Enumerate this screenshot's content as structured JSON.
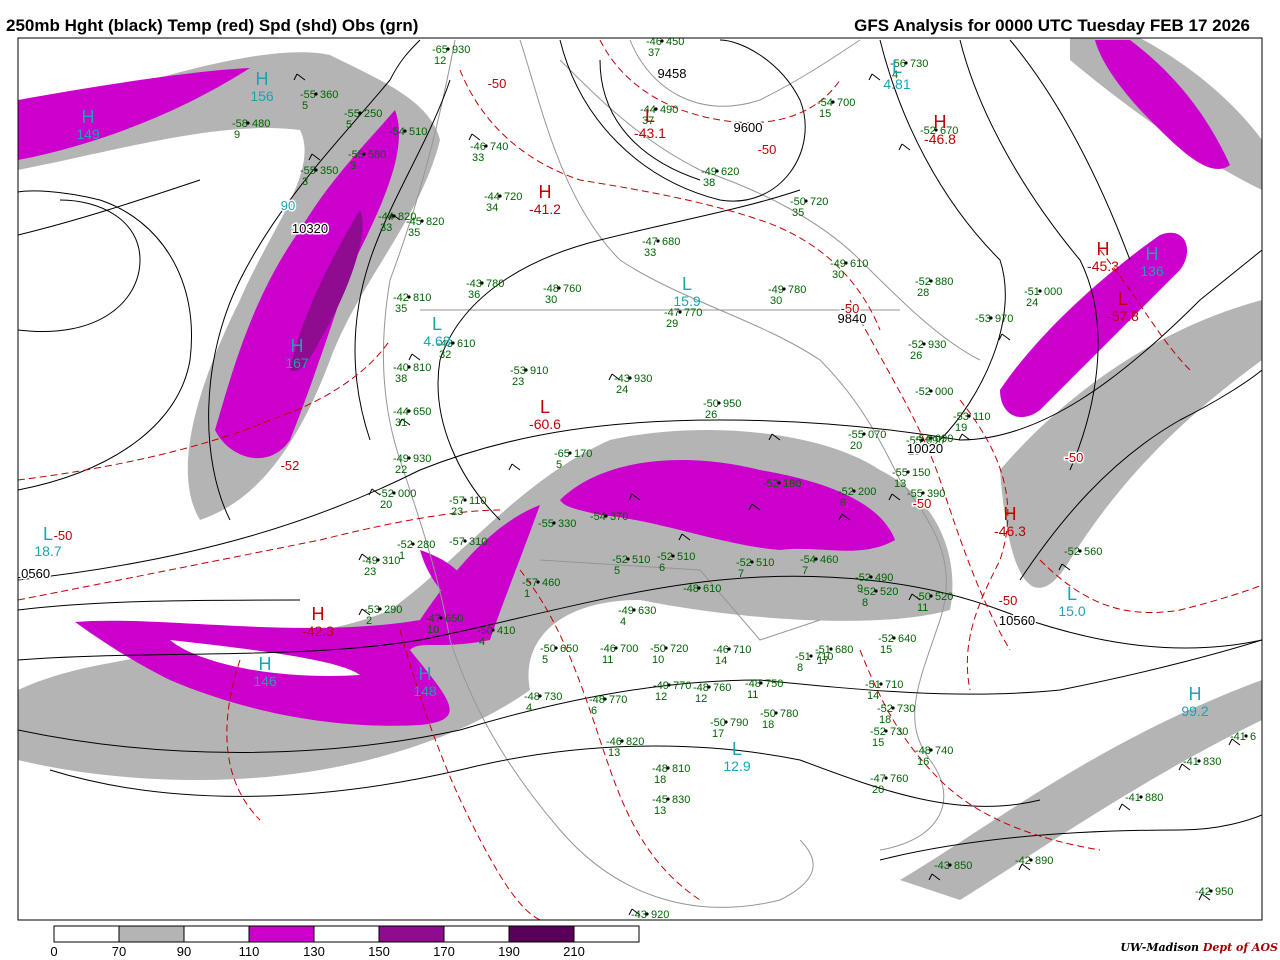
{
  "header": {
    "left_title": "250mb Hght (black) Temp (red) Spd (shd) Obs (grn)",
    "right_title": "GFS Analysis for 0000 UTC Tuesday  FEB 17 2026"
  },
  "credit": {
    "university": "UW-Madison",
    "department": "Dept of AOS"
  },
  "legend": {
    "bins": [
      {
        "color": "#ffffff"
      },
      {
        "color": "#b4b4b4"
      },
      {
        "color": "#ffffff"
      },
      {
        "color": "#cc00cc"
      },
      {
        "color": "#ffffff"
      },
      {
        "color": "#8f0b8f"
      },
      {
        "color": "#ffffff"
      },
      {
        "color": "#5a005a"
      },
      {
        "color": "#ffffff"
      }
    ],
    "tick_labels": [
      "0",
      "70",
      "90",
      "110",
      "130",
      "150",
      "170",
      "190",
      "210"
    ]
  },
  "colors": {
    "height_contour": "#000000",
    "temp_contour": "#c00000",
    "speed_70_90": "#b4b4b4",
    "speed_110_130": "#cc00cc",
    "speed_150_170": "#8f0b8f",
    "centers_label": "#1aa3b5",
    "obs": "#006400",
    "geography": "#969696"
  },
  "centers": [
    {
      "type": "H",
      "value": "149",
      "color": "#1aa3b5"
    },
    {
      "type": "H",
      "value": "156",
      "color": "#1aa3b5"
    },
    {
      "type": "H",
      "value": "167",
      "color": "#1aa3b5"
    },
    {
      "type": "H",
      "value": "146",
      "color": "#1aa3b5"
    },
    {
      "type": "H",
      "value": "148",
      "color": "#1aa3b5"
    },
    {
      "type": "H",
      "value": "136",
      "color": "#1aa3b5"
    },
    {
      "type": "H",
      "value": "99.2",
      "color": "#1aa3b5"
    },
    {
      "type": "L",
      "value": "4.63",
      "color": "#1aa3b5"
    },
    {
      "type": "L",
      "value": "15.9",
      "color": "#1aa3b5"
    },
    {
      "type": "L",
      "value": "15.0",
      "color": "#1aa3b5"
    },
    {
      "type": "L",
      "value": "4.81",
      "color": "#1aa3b5"
    },
    {
      "type": "L",
      "value": "12.9",
      "color": "#1aa3b5"
    },
    {
      "type": "L",
      "value": "18.7",
      "color": "#1aa3b5"
    },
    {
      "type": "L",
      "value": "-60.6",
      "color": "#c00000"
    },
    {
      "type": "H",
      "value": "-41.2",
      "color": "#c00000"
    },
    {
      "type": "L",
      "value": "-43.1",
      "color": "#c00000"
    },
    {
      "type": "H",
      "value": "-45.3",
      "color": "#c00000"
    },
    {
      "type": "H",
      "value": "-42.3",
      "color": "#c00000"
    },
    {
      "type": "H",
      "value": "-46.3",
      "color": "#c00000"
    },
    {
      "type": "H",
      "value": "-46.8",
      "color": "#c00000"
    },
    {
      "type": "L",
      "value": "-57.8",
      "color": "#c00000"
    }
  ],
  "contour_labels": [
    "10320",
    "9840",
    "9600",
    "10560",
    "10560",
    "10020",
    "90",
    "-50",
    "-50",
    "-50",
    "-50",
    "-50",
    "-50",
    "9458",
    "-52",
    "-50"
  ],
  "observations": [
    {
      "t": "-65",
      "h": "930",
      "d": "12"
    },
    {
      "t": "-55",
      "h": "360",
      "d": "5"
    },
    {
      "t": "-58",
      "h": "480",
      "d": "9"
    },
    {
      "t": "-55",
      "h": "250",
      "d": "5"
    },
    {
      "t": "-55",
      "h": "350",
      "d": "3"
    },
    {
      "t": "-55",
      "h": "580",
      "d": "3"
    },
    {
      "t": "-54",
      "h": "510",
      "d": ""
    },
    {
      "t": "-44",
      "h": "820",
      "d": "33"
    },
    {
      "t": "-45",
      "h": "820",
      "d": "35"
    },
    {
      "t": "-46",
      "h": "740",
      "d": "33"
    },
    {
      "t": "-44",
      "h": "720",
      "d": "34"
    },
    {
      "t": "-44",
      "h": "490",
      "d": "37"
    },
    {
      "t": "-46",
      "h": "450",
      "d": "37"
    },
    {
      "t": "-49",
      "h": "620",
      "d": "38"
    },
    {
      "t": "-56",
      "h": "730",
      "d": "4"
    },
    {
      "t": "-54",
      "h": "700",
      "d": "15"
    },
    {
      "t": "-52",
      "h": "670",
      "d": ""
    },
    {
      "t": "-50",
      "h": "720",
      "d": "35"
    },
    {
      "t": "-47",
      "h": "680",
      "d": "33"
    },
    {
      "t": "-49",
      "h": "610",
      "d": "30"
    },
    {
      "t": "-49",
      "h": "780",
      "d": "30"
    },
    {
      "t": "-52",
      "h": "880",
      "d": "28"
    },
    {
      "t": "-51",
      "h": "000",
      "d": "24"
    },
    {
      "t": "-53",
      "h": "970",
      "d": ""
    },
    {
      "t": "-52",
      "h": "930",
      "d": "26"
    },
    {
      "t": "-52",
      "h": "000",
      "d": ""
    },
    {
      "t": "-53",
      "h": "110",
      "d": "19"
    },
    {
      "t": "-54",
      "h": "090",
      "d": ""
    },
    {
      "t": "-43",
      "h": "780",
      "d": "36"
    },
    {
      "t": "-48",
      "h": "760",
      "d": "30"
    },
    {
      "t": "-47",
      "h": "770",
      "d": "29"
    },
    {
      "t": "-42",
      "h": "810",
      "d": "35"
    },
    {
      "t": "-43",
      "h": "610",
      "d": "32"
    },
    {
      "t": "-40",
      "h": "810",
      "d": "38"
    },
    {
      "t": "-53",
      "h": "910",
      "d": "23"
    },
    {
      "t": "-43",
      "h": "930",
      "d": "24"
    },
    {
      "t": "-50",
      "h": "950",
      "d": "26"
    },
    {
      "t": "-44",
      "h": "650",
      "d": "31"
    },
    {
      "t": "-49",
      "h": "930",
      "d": "22"
    },
    {
      "t": "-55",
      "h": "070",
      "d": "20"
    },
    {
      "t": "-55",
      "h": "150",
      "d": "13"
    },
    {
      "t": "-55",
      "h": "090",
      "d": "16"
    },
    {
      "t": "-52",
      "h": "000",
      "d": "20"
    },
    {
      "t": "-57",
      "h": "110",
      "d": "23"
    },
    {
      "t": "-65",
      "h": "170",
      "d": "5"
    },
    {
      "t": "-52",
      "h": "180",
      "d": ""
    },
    {
      "t": "-52",
      "h": "200",
      "d": "8"
    },
    {
      "t": "-55",
      "h": "390",
      "d": ""
    },
    {
      "t": "-54",
      "h": "370",
      "d": ""
    },
    {
      "t": "-55",
      "h": "330",
      "d": ""
    },
    {
      "t": "-52",
      "h": "280",
      "d": "1"
    },
    {
      "t": "-57",
      "h": "310",
      "d": ""
    },
    {
      "t": "-49",
      "h": "310",
      "d": "23"
    },
    {
      "t": "-57",
      "h": "460",
      "d": "1"
    },
    {
      "t": "-52",
      "h": "510",
      "d": "5"
    },
    {
      "t": "-52",
      "h": "510",
      "d": "6"
    },
    {
      "t": "-52",
      "h": "510",
      "d": "7"
    },
    {
      "t": "-54",
      "h": "460",
      "d": "7"
    },
    {
      "t": "-52",
      "h": "490",
      "d": "9"
    },
    {
      "t": "-52",
      "h": "520",
      "d": "8"
    },
    {
      "t": "-50",
      "h": "520",
      "d": "11"
    },
    {
      "t": "-49",
      "h": "630",
      "d": "4"
    },
    {
      "t": "-53",
      "h": "290",
      "d": "2"
    },
    {
      "t": "-50",
      "h": "410",
      "d": "4"
    },
    {
      "t": "-47",
      "h": "650",
      "d": "10"
    },
    {
      "t": "-48",
      "h": "610",
      "d": ""
    },
    {
      "t": "-50",
      "h": "650",
      "d": "5"
    },
    {
      "t": "-46",
      "h": "700",
      "d": "11"
    },
    {
      "t": "-50",
      "h": "720",
      "d": "10"
    },
    {
      "t": "-46",
      "h": "710",
      "d": "14"
    },
    {
      "t": "-51",
      "h": "710",
      "d": "8"
    },
    {
      "t": "-51",
      "h": "680",
      "d": "17"
    },
    {
      "t": "-52",
      "h": "640",
      "d": "15"
    },
    {
      "t": "-51",
      "h": "710",
      "d": "14"
    },
    {
      "t": "-49",
      "h": "770",
      "d": "12"
    },
    {
      "t": "-48",
      "h": "760",
      "d": "12"
    },
    {
      "t": "-48",
      "h": "750",
      "d": "11"
    },
    {
      "t": "-50",
      "h": "780",
      "d": "18"
    },
    {
      "t": "-52",
      "h": "730",
      "d": "18"
    },
    {
      "t": "-52",
      "h": "730",
      "d": "15"
    },
    {
      "t": "-48",
      "h": "730",
      "d": "4"
    },
    {
      "t": "-48",
      "h": "770",
      "d": "6"
    },
    {
      "t": "-50",
      "h": "790",
      "d": "17"
    },
    {
      "t": "-48",
      "h": "740",
      "d": "16"
    },
    {
      "t": "-47",
      "h": "760",
      "d": "20"
    },
    {
      "t": "-46",
      "h": "820",
      "d": "13"
    },
    {
      "t": "-48",
      "h": "810",
      "d": "18"
    },
    {
      "t": "-45",
      "h": "830",
      "d": "13"
    },
    {
      "t": "-52",
      "h": "560",
      "d": ""
    },
    {
      "t": "-41",
      "h": "830",
      "d": ""
    },
    {
      "t": "-41",
      "h": "880",
      "d": ""
    },
    {
      "t": "-41",
      "h": "6",
      "d": ""
    },
    {
      "t": "-43",
      "h": "850",
      "d": ""
    },
    {
      "t": "-42",
      "h": "890",
      "d": ""
    },
    {
      "t": "-42",
      "h": "950",
      "d": ""
    },
    {
      "t": "-43",
      "h": "920",
      "d": ""
    }
  ]
}
